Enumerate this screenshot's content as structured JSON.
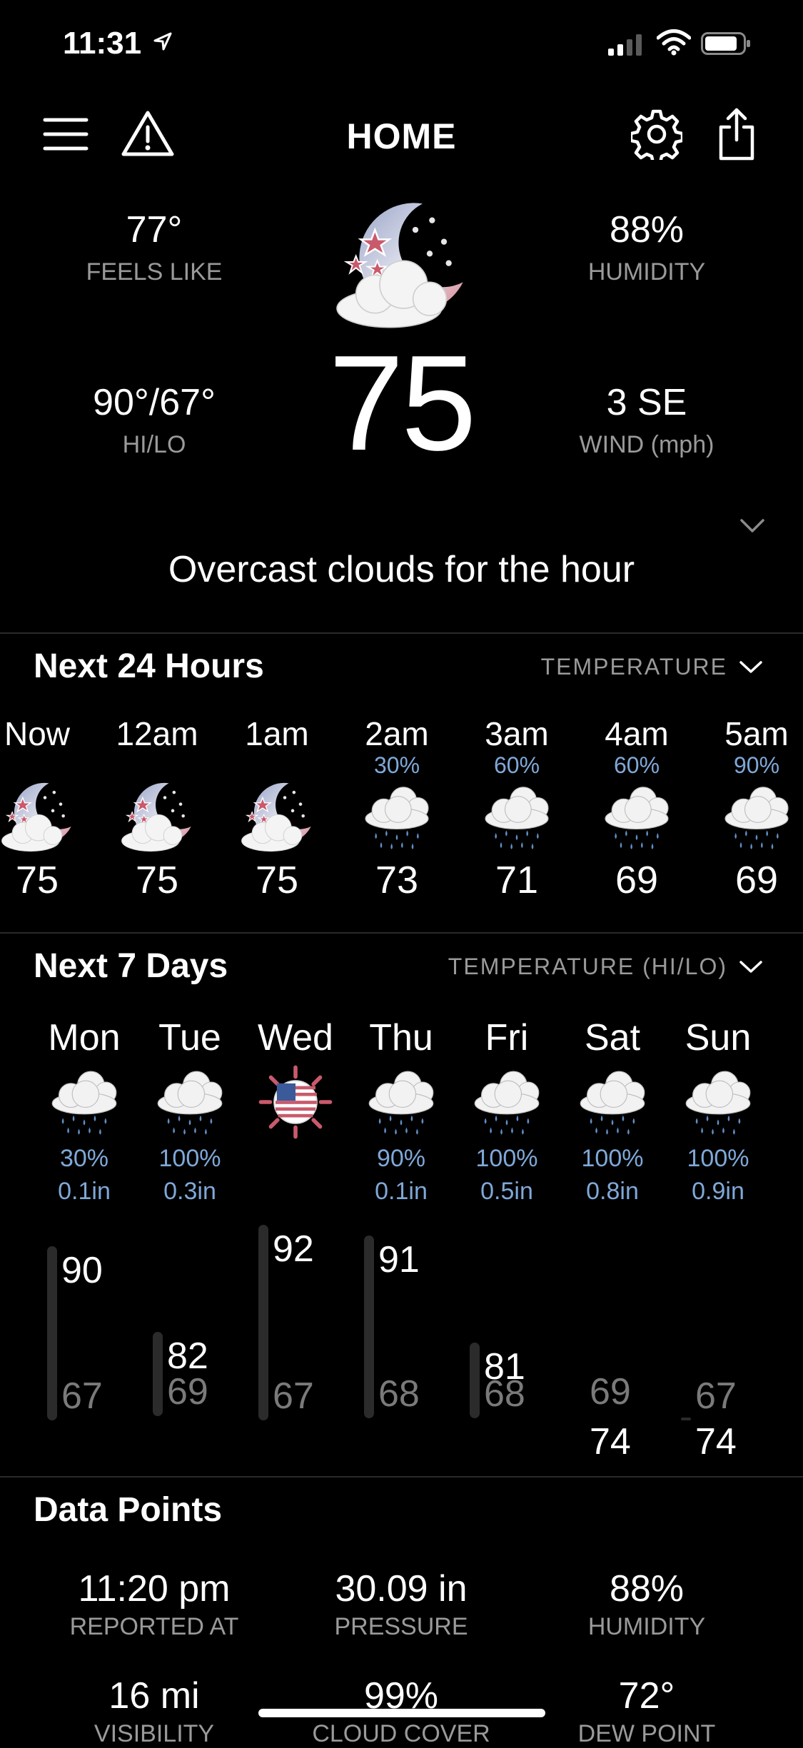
{
  "status_bar": {
    "time": "11:31"
  },
  "header": {
    "title": "HOME"
  },
  "current": {
    "feels_like": {
      "value": "77°",
      "label": "FEELS LIKE"
    },
    "humidity": {
      "value": "88%",
      "label": "HUMIDITY"
    },
    "hilo": {
      "value": "90°/67°",
      "label": "HI/LO"
    },
    "wind": {
      "value": "3 SE",
      "label": "WIND (mph)"
    },
    "temp": "75",
    "summary": "Overcast clouds for the hour",
    "icon": "night-cloudy-flag-icon"
  },
  "hourly": {
    "title": "Next 24 Hours",
    "selector": "TEMPERATURE",
    "items": [
      {
        "time": "Now",
        "precip": "",
        "temp": "75",
        "icon": "night-cloudy-icon"
      },
      {
        "time": "12am",
        "precip": "",
        "temp": "75",
        "icon": "night-cloudy-icon"
      },
      {
        "time": "1am",
        "precip": "",
        "temp": "75",
        "icon": "night-cloudy-icon"
      },
      {
        "time": "2am",
        "precip": "30%",
        "temp": "73",
        "icon": "rain-icon"
      },
      {
        "time": "3am",
        "precip": "60%",
        "temp": "71",
        "icon": "rain-icon"
      },
      {
        "time": "4am",
        "precip": "60%",
        "temp": "69",
        "icon": "rain-icon"
      },
      {
        "time": "5am",
        "precip": "90%",
        "temp": "69",
        "icon": "rain-icon"
      }
    ]
  },
  "daily": {
    "title": "Next 7 Days",
    "selector": "TEMPERATURE (HI/LO)",
    "items": [
      {
        "day": "Mon",
        "chance": "30%",
        "amount": "0.1in",
        "hi": "90",
        "lo": "67",
        "icon": "rain-icon"
      },
      {
        "day": "Tue",
        "chance": "100%",
        "amount": "0.3in",
        "hi": "82",
        "lo": "69",
        "icon": "rain-icon"
      },
      {
        "day": "Wed",
        "chance": "",
        "amount": "",
        "hi": "92",
        "lo": "67",
        "icon": "sun-flag-icon"
      },
      {
        "day": "Thu",
        "chance": "90%",
        "amount": "0.1in",
        "hi": "91",
        "lo": "68",
        "icon": "rain-icon"
      },
      {
        "day": "Fri",
        "chance": "100%",
        "amount": "0.5in",
        "hi": "81",
        "lo": "68",
        "icon": "rain-icon"
      },
      {
        "day": "Sat",
        "chance": "100%",
        "amount": "0.8in",
        "hi": "74",
        "lo": "69",
        "icon": "rain-icon"
      },
      {
        "day": "Sun",
        "chance": "100%",
        "amount": "0.9in",
        "hi": "74",
        "lo": "67",
        "icon": "rain-icon"
      }
    ]
  },
  "data_points": {
    "title": "Data Points",
    "items": [
      {
        "value": "11:20 pm",
        "label": "REPORTED AT"
      },
      {
        "value": "30.09 in",
        "label": "PRESSURE"
      },
      {
        "value": "88%",
        "label": "HUMIDITY"
      },
      {
        "value": "16 mi",
        "label": "VISIBILITY"
      },
      {
        "value": "99%",
        "label": "CLOUD COVER"
      },
      {
        "value": "72°",
        "label": "DEW POINT"
      }
    ]
  }
}
